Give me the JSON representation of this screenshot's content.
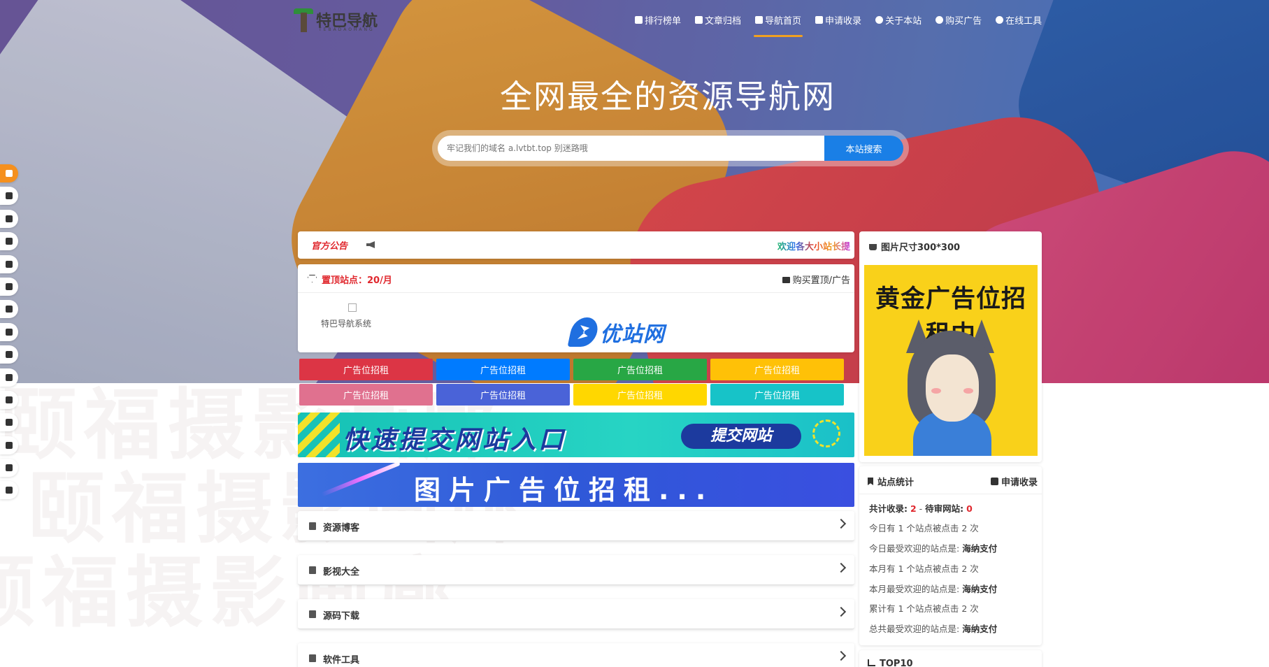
{
  "site": {
    "logo_text": "特巴导航",
    "logo_sub": "TEBADAOHANG"
  },
  "nav": {
    "items": [
      {
        "label": "排行榜单",
        "icon": "ranking-icon"
      },
      {
        "label": "文章归档",
        "icon": "archive-icon"
      },
      {
        "label": "导航首页",
        "icon": "home-icon",
        "active": true
      },
      {
        "label": "申请收录",
        "icon": "plus-square-icon"
      },
      {
        "label": "关于本站",
        "icon": "info-icon"
      },
      {
        "label": "购买广告",
        "icon": "info-icon"
      },
      {
        "label": "在线工具",
        "icon": "info-icon"
      }
    ]
  },
  "hero": {
    "title": "全网最全的资源导航网",
    "search_placeholder": "牢记我们的域名 a.lvtbt.top 别迷路哦",
    "search_button": "本站搜索"
  },
  "side_rail": {
    "icons": [
      "thumbs-up-icon",
      "book-icon",
      "file-icon",
      "cloud-download-icon",
      "download-icon",
      "desktop-icon",
      "edit-icon",
      "music-icon",
      "address-book-icon",
      "paypal-icon",
      "briefcase-icon",
      "image-icon",
      "refresh-icon",
      "send-icon",
      "leaf-icon"
    ]
  },
  "notice": {
    "label": "官方公告",
    "marquee": "欢迎各大小站长提"
  },
  "top_sites": {
    "title": "置顶站点：20/月",
    "buy_link": "购买置顶/广告",
    "tile_name": "特巴导航系统",
    "partner_logo": "优站网"
  },
  "ad_slots": {
    "label": "广告位招租",
    "colors": [
      "#dc3545",
      "#007bff",
      "#28a745",
      "#ffc107",
      "#e0718f",
      "#4a63d8",
      "#ffd700",
      "#17c3c8"
    ]
  },
  "banners": {
    "submit_title": "快速提交网站入口",
    "submit_button": "提交网站",
    "image_ad": "图片广告位招租..."
  },
  "categories": [
    {
      "label": "资源博客",
      "icon": "book-icon"
    },
    {
      "label": "影视大全",
      "icon": "file-icon"
    },
    {
      "label": "源码下载",
      "icon": "cloud-download-icon"
    },
    {
      "label": "软件工具",
      "icon": "download-icon"
    }
  ],
  "right_ad": {
    "header": "图片尺寸300*300",
    "image_text": "黄金广告位招租中"
  },
  "stats": {
    "title": "站点统计",
    "apply": "申请收录",
    "total_label": "共计收录:",
    "total_value": "2",
    "sep": "-",
    "pending_label": "待审网站:",
    "pending_value": "0",
    "rows": [
      {
        "text": "今日有 1 个站点被点击 2 次",
        "bold": ""
      },
      {
        "text": "今日最受欢迎的站点是:",
        "bold": "海纳支付"
      },
      {
        "text": "本月有 1 个站点被点击 2 次",
        "bold": ""
      },
      {
        "text": "本月最受欢迎的站点是:",
        "bold": "海纳支付"
      },
      {
        "text": "累计有 1 个站点被点击 2 次",
        "bold": ""
      },
      {
        "text": "总共最受欢迎的站点是:",
        "bold": "海纳支付"
      }
    ]
  },
  "top10": {
    "title": "TOP10"
  },
  "watermark": "颐福摄影画廊"
}
